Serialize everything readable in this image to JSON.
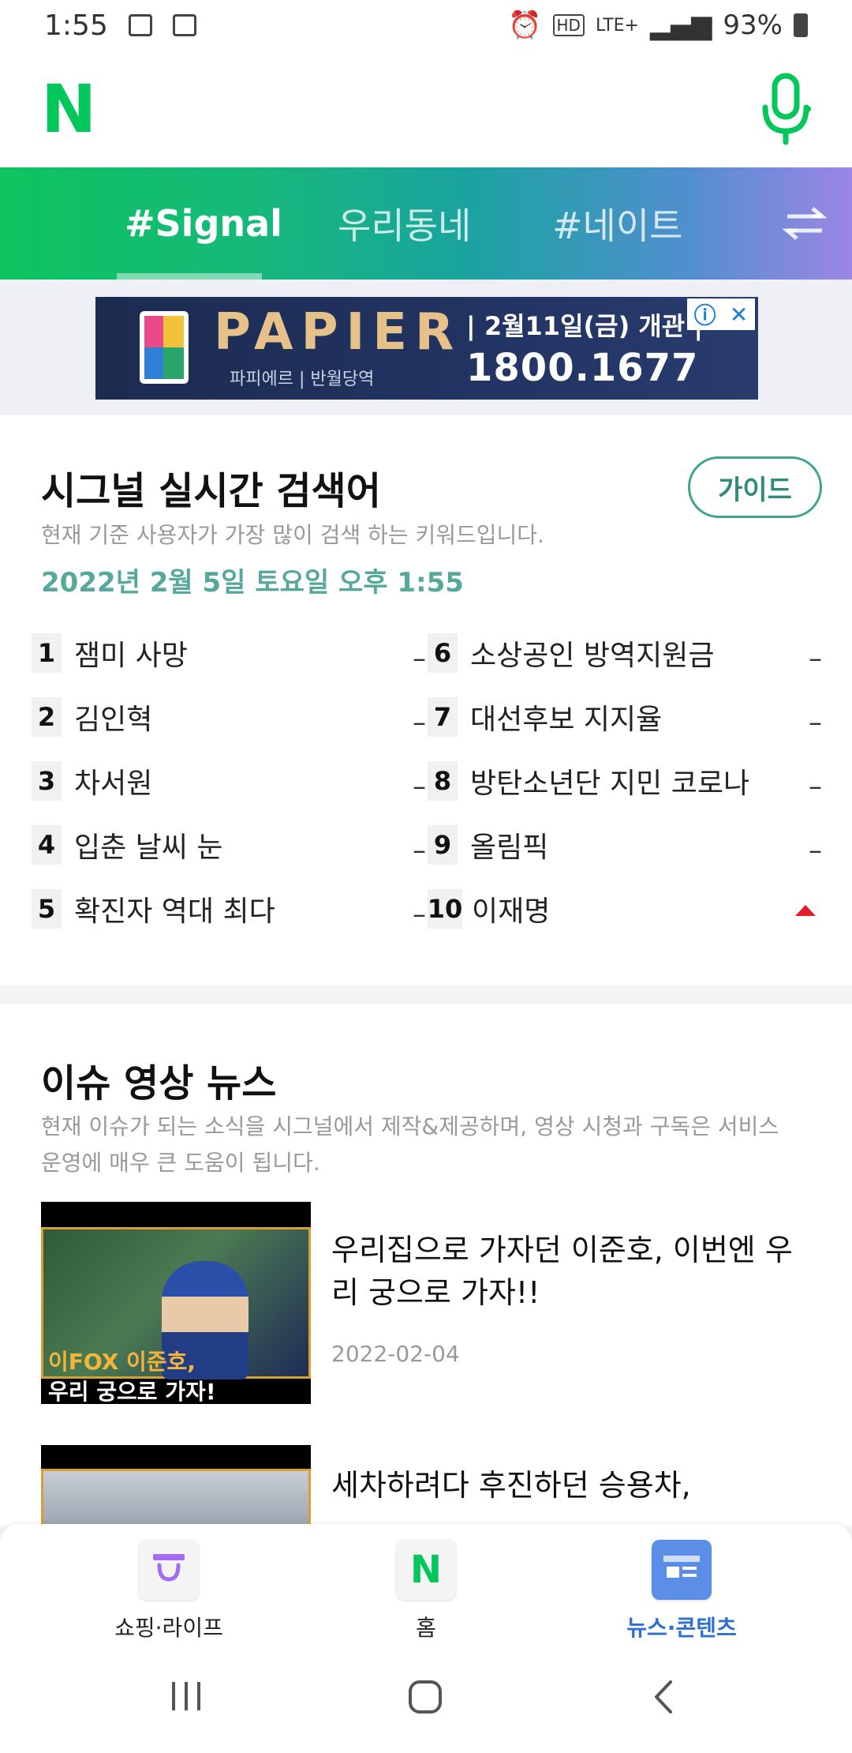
{
  "status_bar": {
    "time": "1:55",
    "network": "LTE+",
    "battery": "93%"
  },
  "header": {
    "logo": "N"
  },
  "tabs": {
    "items": [
      {
        "label": "#Signal",
        "active": true
      },
      {
        "label": "우리동네",
        "active": false
      },
      {
        "label": "#네이트",
        "active": false
      }
    ]
  },
  "ad": {
    "brand": "PAPIER",
    "sub": "파피에르 | 반월당역",
    "date": "| 2월11일(금) 개관 |",
    "phone": "1800.1677"
  },
  "realtime": {
    "title": "시그널 실시간 검색어",
    "guide_label": "가이드",
    "description": "현재 기준 사용자가 가장 많이 검색 하는 키워드입니다.",
    "datetime": "2022년 2월 5일 토요일 오후 1:55",
    "ranks": [
      {
        "rank": "1",
        "keyword": "잼미 사망",
        "change": "–"
      },
      {
        "rank": "2",
        "keyword": "김인혁",
        "change": "–"
      },
      {
        "rank": "3",
        "keyword": "차서원",
        "change": "–"
      },
      {
        "rank": "4",
        "keyword": "입춘 날씨 눈",
        "change": "–"
      },
      {
        "rank": "5",
        "keyword": "확진자 역대 최다",
        "change": "–"
      },
      {
        "rank": "6",
        "keyword": "소상공인 방역지원금",
        "change": "–"
      },
      {
        "rank": "7",
        "keyword": "대선후보 지지율",
        "change": "–"
      },
      {
        "rank": "8",
        "keyword": "방탄소년단 지민 코로나",
        "change": "–"
      },
      {
        "rank": "9",
        "keyword": "올림픽",
        "change": "–"
      },
      {
        "rank": "10",
        "keyword": "이재명",
        "change": "up"
      }
    ]
  },
  "video_news": {
    "title": "이슈 영상 뉴스",
    "description": "현재 이슈가 되는 소식을 시그널에서 제작&제공하며, 영상 시청과 구독은 서비스 운영에 매우 큰 도움이 됩니다.",
    "items": [
      {
        "title": "우리집으로 가자던 이준호, 이번엔 우리 궁으로 가자!!",
        "date": "2022-02-04",
        "thumb_caption_1": "이FOX 이준호,",
        "thumb_caption_2": "우리 궁으로 가자!"
      },
      {
        "title": "세차하려다 후진하던 승용차,",
        "date": ""
      }
    ]
  },
  "bottom_nav": {
    "items": [
      {
        "label": "쇼핑·라이프",
        "icon": "shopping-bag-icon",
        "active": false
      },
      {
        "label": "홈",
        "icon": "naver-home-icon",
        "active": false
      },
      {
        "label": "뉴스·콘텐츠",
        "icon": "news-icon",
        "active": true
      }
    ]
  },
  "colors": {
    "brand": "#03c75a",
    "accent_teal": "#3fa38e",
    "active_nav": "#2f6fd0",
    "rank_up": "#e21c2a"
  }
}
